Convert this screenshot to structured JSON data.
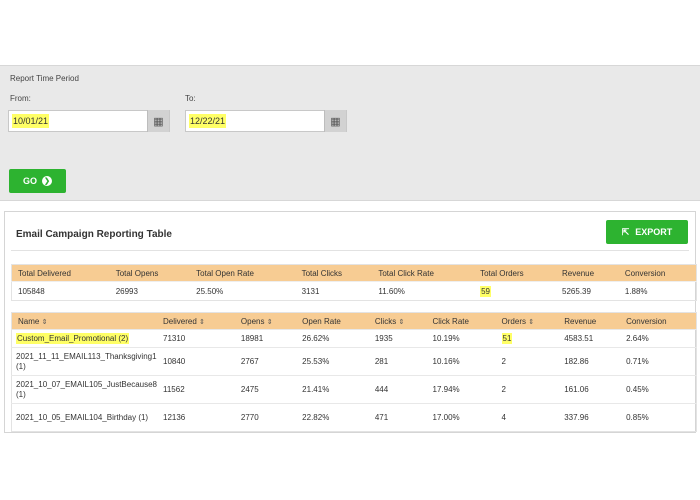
{
  "period": {
    "title": "Report Time Period",
    "from_label": "From:",
    "to_label": "To:",
    "from_value": "10/01/21",
    "to_value": "12/22/21",
    "go_label": "GO"
  },
  "table": {
    "title": "Email Campaign Reporting Table",
    "export_label": "EXPORT",
    "summary_headers": [
      "Total Delivered",
      "Total Opens",
      "Total Open Rate",
      "Total Clicks",
      "Total Click Rate",
      "Total Orders",
      "Revenue",
      "Conversion"
    ],
    "summary_values": [
      "105848",
      "26993",
      "25.50%",
      "3131",
      "11.60%",
      "59",
      "5265.39",
      "1.88%"
    ],
    "detail_headers": [
      "Name",
      "Delivered",
      "Opens",
      "Open Rate",
      "Clicks",
      "Click Rate",
      "Orders",
      "Revenue",
      "Conversion"
    ],
    "rows": [
      [
        "Custom_Email_Promotional (2)",
        "71310",
        "18981",
        "26.62%",
        "1935",
        "10.19%",
        "51",
        "4583.51",
        "2.64%"
      ],
      [
        "2021_11_11_EMAIL113_Thanksgiving1 (1)",
        "10840",
        "2767",
        "25.53%",
        "281",
        "10.16%",
        "2",
        "182.86",
        "0.71%"
      ],
      [
        "2021_10_07_EMAIL105_JustBecause8 (1)",
        "11562",
        "2475",
        "21.41%",
        "444",
        "17.94%",
        "2",
        "161.06",
        "0.45%"
      ],
      [
        "2021_10_05_EMAIL104_Birthday (1)",
        "12136",
        "2770",
        "22.82%",
        "471",
        "17.00%",
        "4",
        "337.96",
        "0.85%"
      ]
    ]
  },
  "colors": {
    "accent_green": "#2db330",
    "header_orange": "#f7cc93",
    "highlight_yellow": "#ffff66"
  }
}
